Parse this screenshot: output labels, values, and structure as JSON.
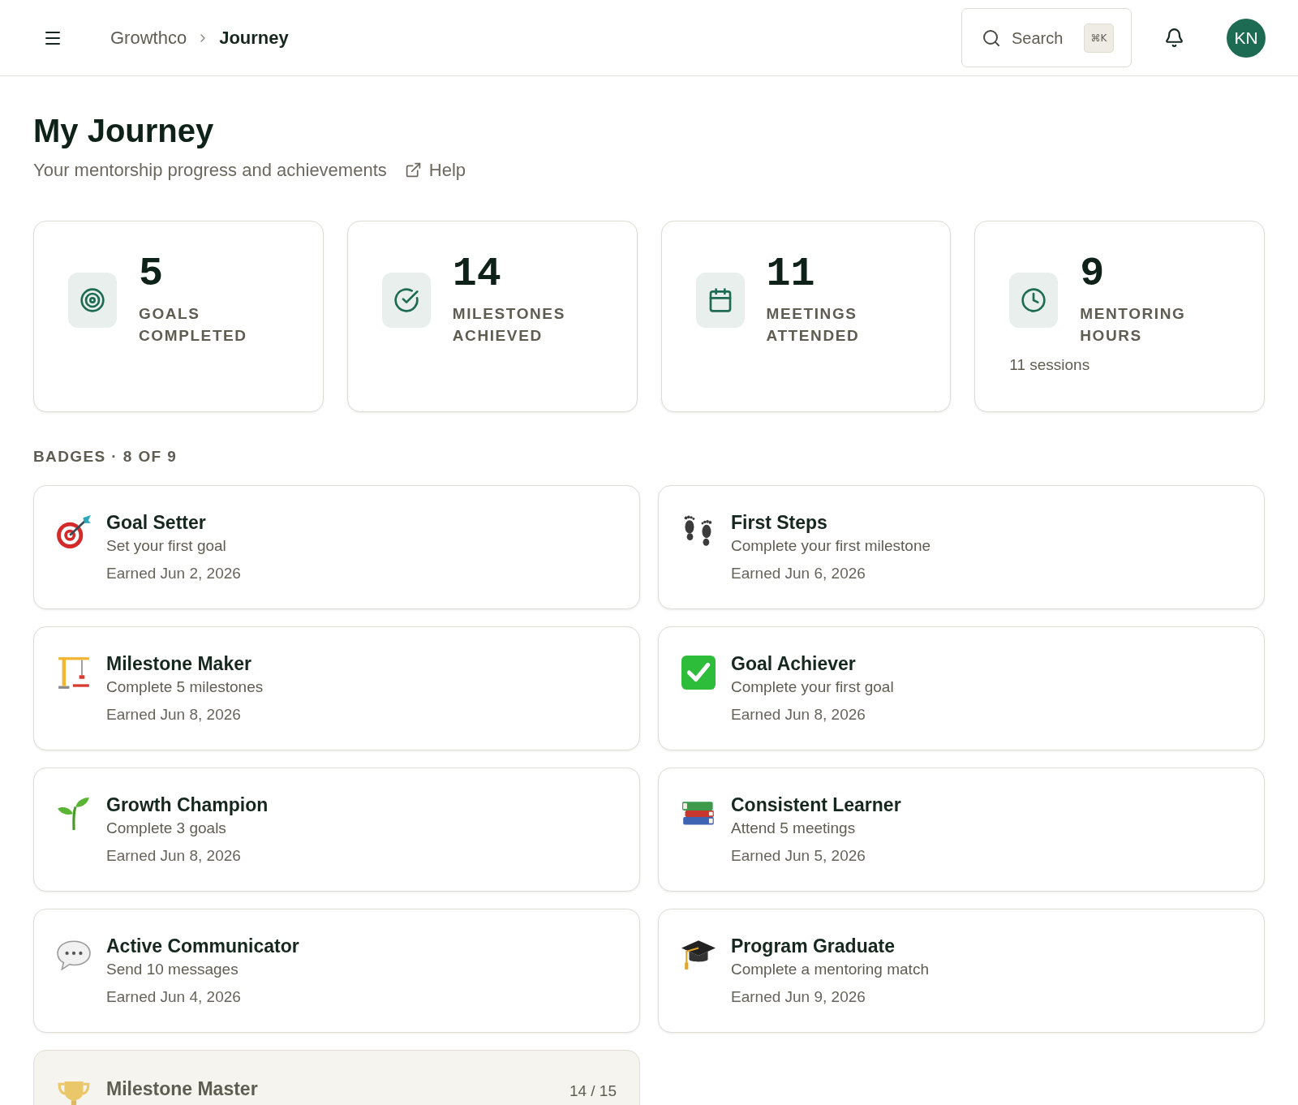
{
  "header": {
    "breadcrumb": [
      {
        "label": "Growthco",
        "current": false
      },
      {
        "label": "Journey",
        "current": true
      }
    ],
    "search": {
      "label": "Search",
      "shortcut": "⌘K"
    },
    "avatar": {
      "initials": "KN"
    }
  },
  "page": {
    "title": "My Journey",
    "subtitle": "Your mentorship progress and achievements",
    "help_link": "Help"
  },
  "stats": [
    {
      "value": "5",
      "label": "GOALS COMPLETED"
    },
    {
      "value": "14",
      "label": "MILESTONES ACHIEVED"
    },
    {
      "value": "11",
      "label": "MEETINGS ATTENDED"
    },
    {
      "value": "9",
      "label": "MENTORING HOURS",
      "note": "11 sessions"
    }
  ],
  "badges": {
    "heading": "BADGES · 8 OF 9",
    "items": [
      {
        "title": "Goal Setter",
        "description": "Set your first goal",
        "earned": true,
        "earned_on": "Earned Jun 2, 2026"
      },
      {
        "title": "First Steps",
        "description": "Complete your first milestone",
        "earned": true,
        "earned_on": "Earned Jun 6, 2026"
      },
      {
        "title": "Milestone Maker",
        "description": "Complete 5 milestones",
        "earned": true,
        "earned_on": "Earned Jun 8, 2026"
      },
      {
        "title": "Goal Achiever",
        "description": "Complete your first goal",
        "earned": true,
        "earned_on": "Earned Jun 8, 2026"
      },
      {
        "title": "Growth Champion",
        "description": "Complete 3 goals",
        "earned": true,
        "earned_on": "Earned Jun 8, 2026"
      },
      {
        "title": "Consistent Learner",
        "description": "Attend 5 meetings",
        "earned": true,
        "earned_on": "Earned Jun 5, 2026"
      },
      {
        "title": "Active Communicator",
        "description": "Send 10 messages",
        "earned": true,
        "earned_on": "Earned Jun 4, 2026"
      },
      {
        "title": "Program Graduate",
        "description": "Complete a mentoring match",
        "earned": true,
        "earned_on": "Earned Jun 9, 2026"
      },
      {
        "title": "Milestone Master",
        "earned": false,
        "progress": "14 / 15"
      }
    ]
  }
}
